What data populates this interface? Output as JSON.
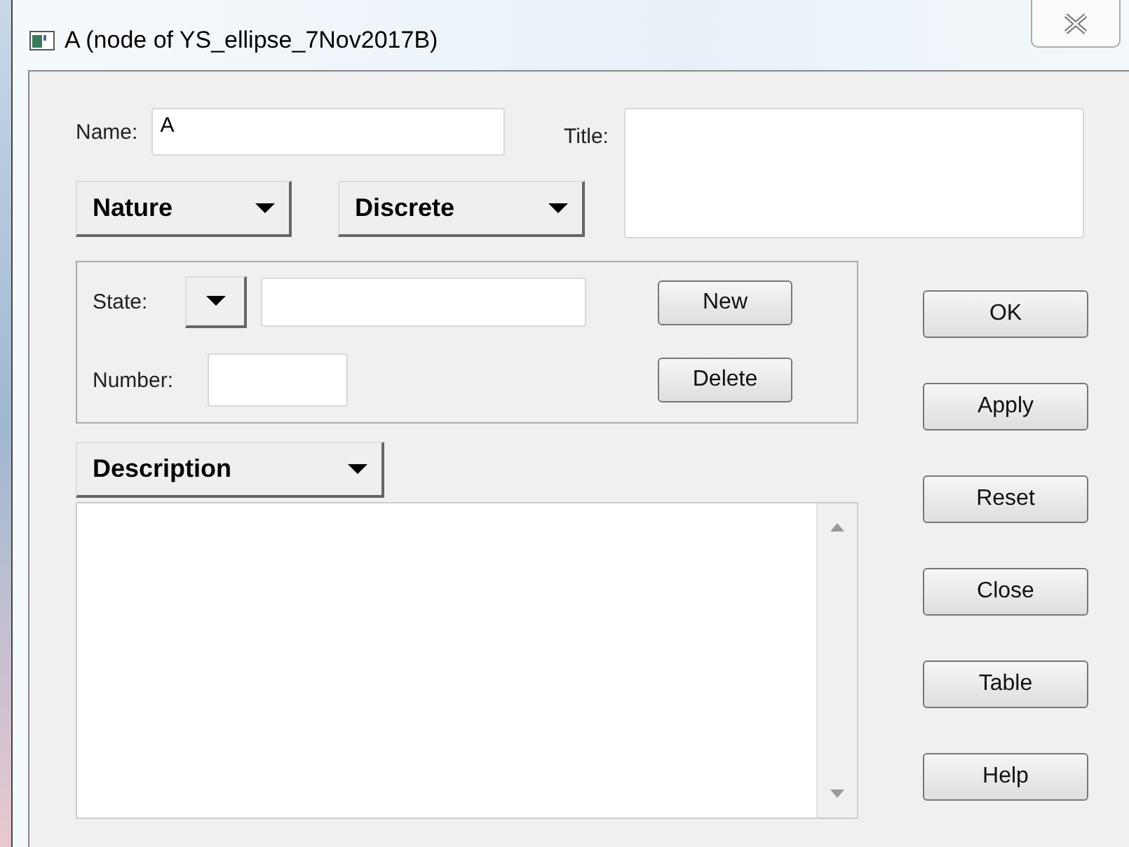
{
  "window": {
    "title": "A (node of YS_ellipse_7Nov2017B)"
  },
  "name_field": {
    "label": "Name:",
    "value": "A"
  },
  "title_field": {
    "label": "Title:"
  },
  "type_menus": [
    "Nature",
    "Discrete"
  ],
  "states_group": {
    "state_label": "State:",
    "number_label": "Number:",
    "buttons": [
      "New",
      "Delete"
    ]
  },
  "description_menu": "Description",
  "side_buttons": [
    "OK",
    "Apply",
    "Reset",
    "Close",
    "Table",
    "Help"
  ]
}
